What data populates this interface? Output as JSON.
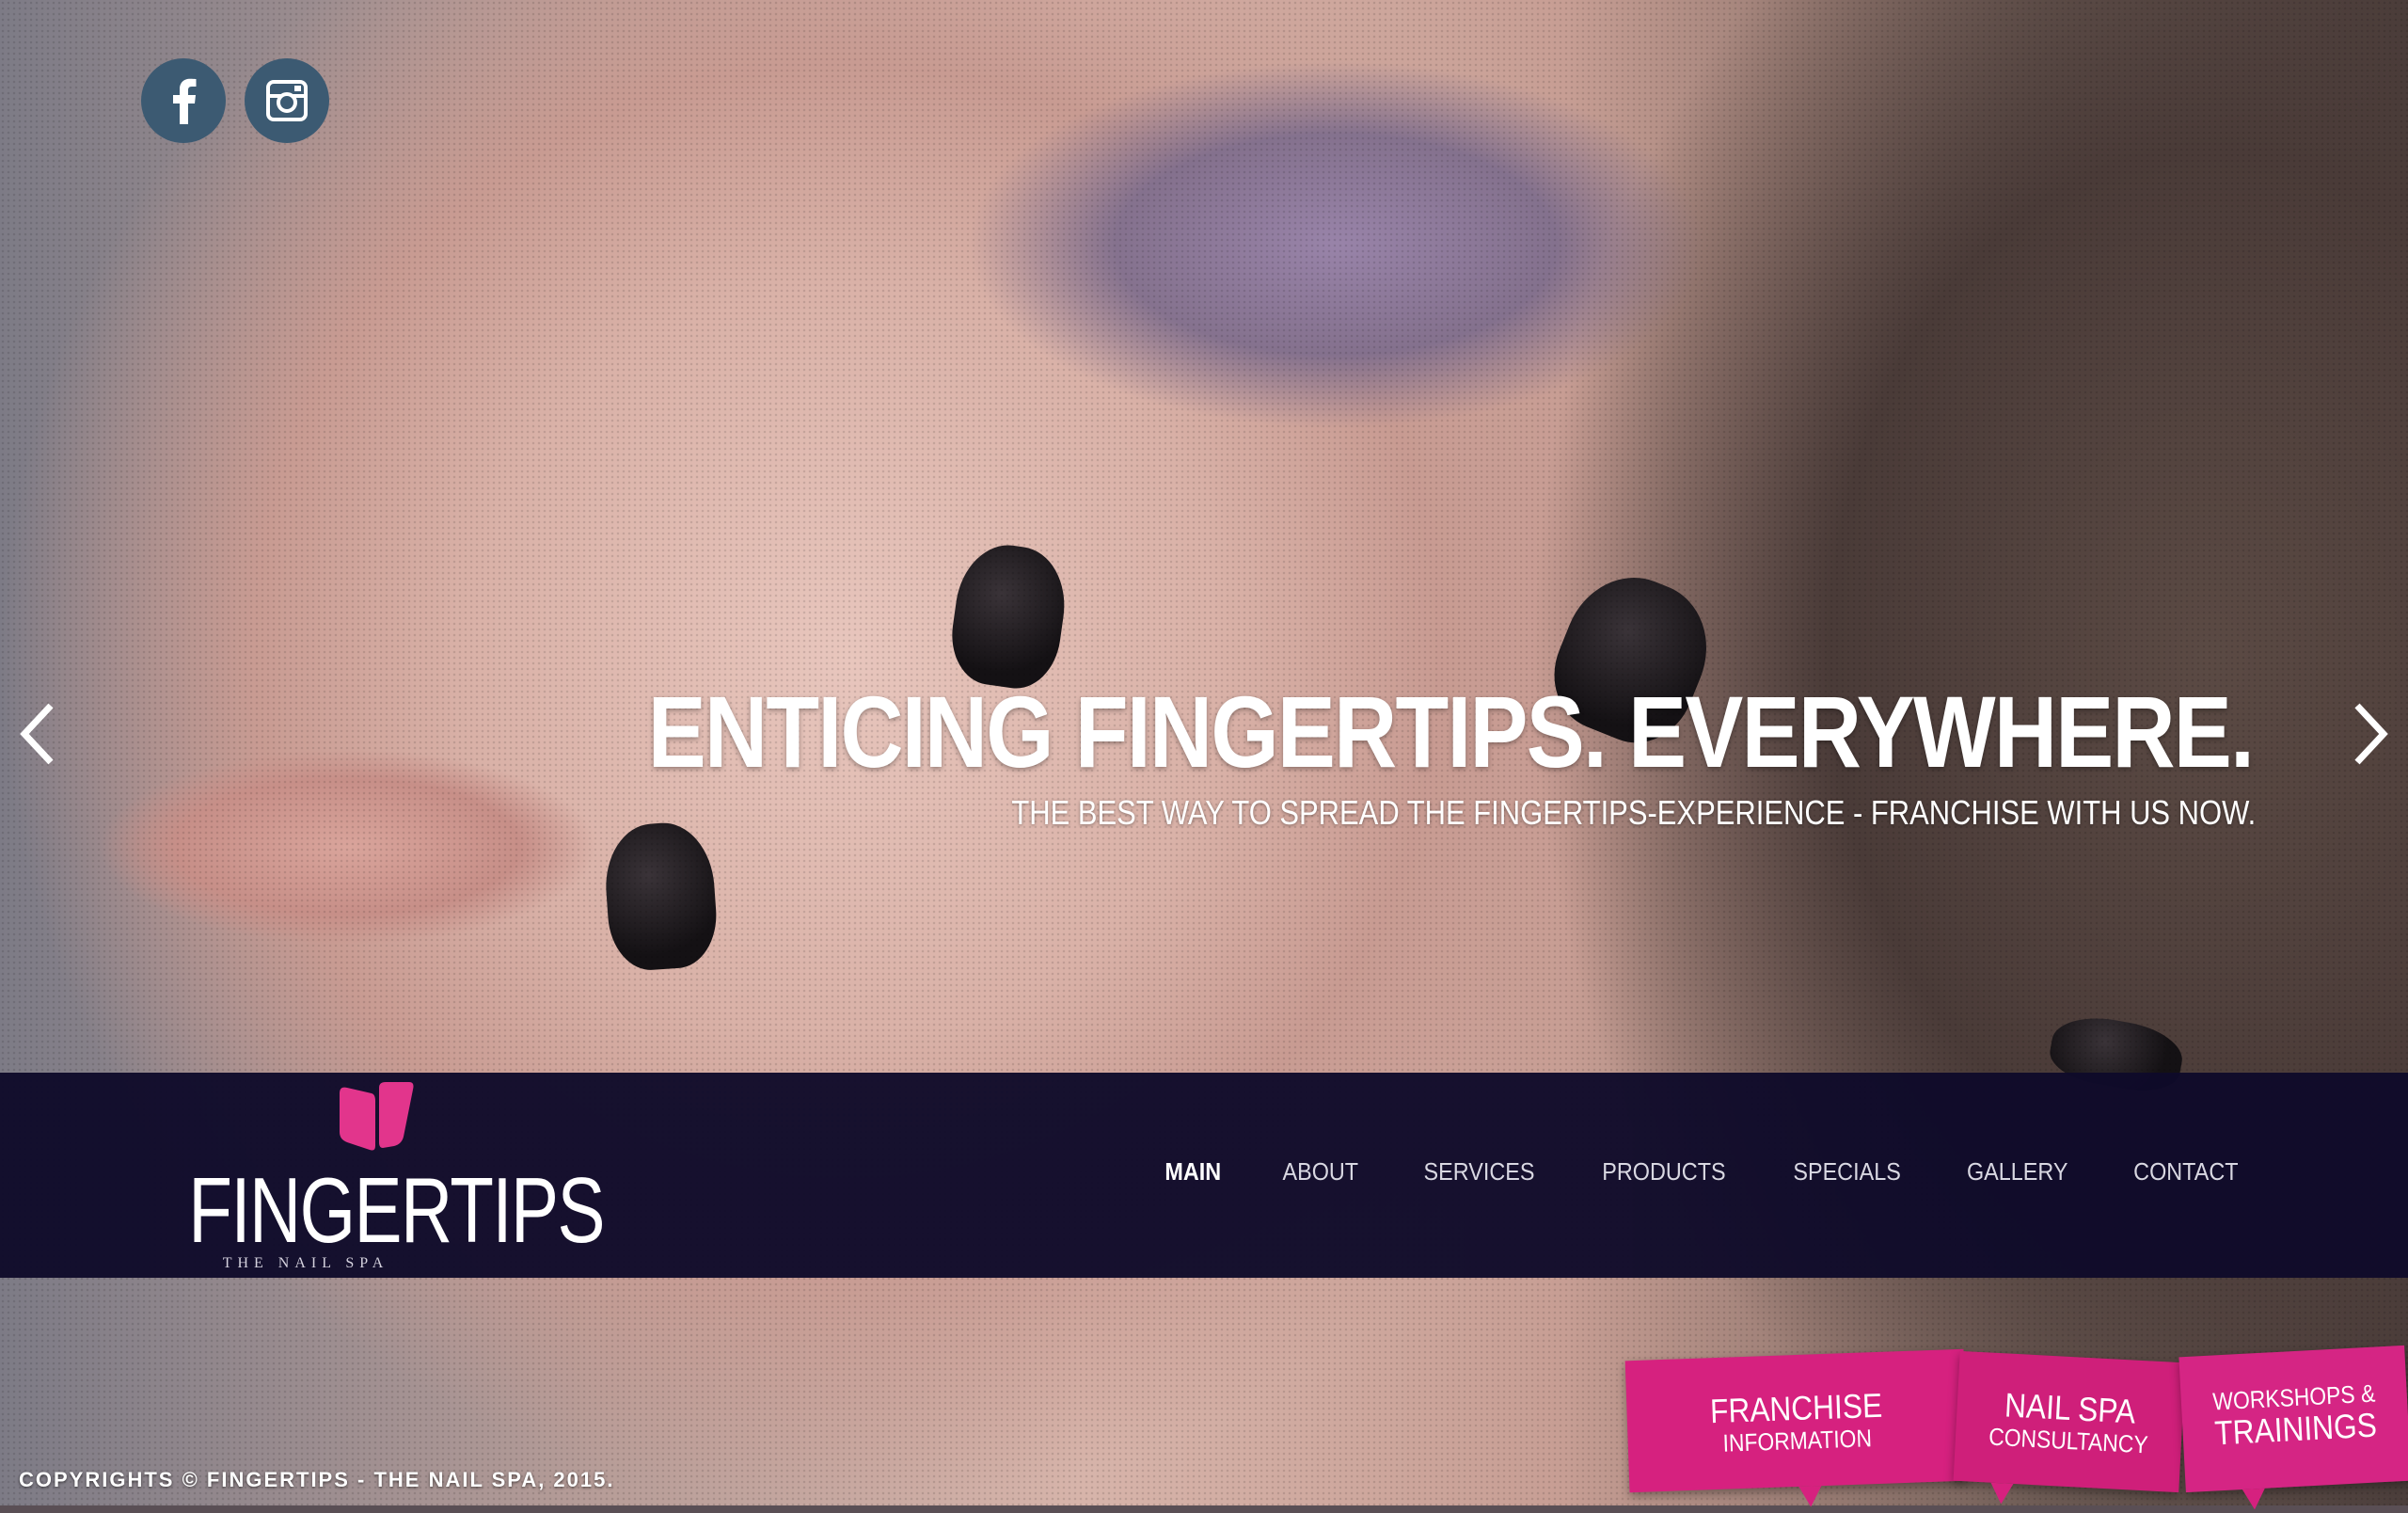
{
  "brand": {
    "name": "FINGERTIPS",
    "tagline": "THE NAIL SPA",
    "accent_color": "#e2358c",
    "nav_bg_color": "#0f0a2a",
    "social_color": "#3c5a72"
  },
  "social": [
    {
      "icon": "facebook-icon"
    },
    {
      "icon": "instagram-icon"
    }
  ],
  "slider": {
    "headline": "ENTICING FINGERTIPS. EVERYWHERE.",
    "subline": "THE BEST WAY TO SPREAD THE FINGERTIPS-EXPERIENCE - FRANCHISE WITH US NOW.",
    "prev_icon": "chevron-left-icon",
    "next_icon": "chevron-right-icon"
  },
  "nav": {
    "items": [
      {
        "label": "MAIN",
        "active": true
      },
      {
        "label": "ABOUT",
        "active": false
      },
      {
        "label": "SERVICES",
        "active": false
      },
      {
        "label": "PRODUCTS",
        "active": false
      },
      {
        "label": "SPECIALS",
        "active": false
      },
      {
        "label": "GALLERY",
        "active": false
      },
      {
        "label": "CONTACT",
        "active": false
      }
    ]
  },
  "tags": [
    {
      "line1": "FRANCHISE",
      "line2": "INFORMATION"
    },
    {
      "line1": "NAIL SPA",
      "line2": "CONSULTANCY"
    },
    {
      "line1": "WORKSHOPS &",
      "line2": "TRAININGS"
    }
  ],
  "footer": {
    "copyright": "COPYRIGHTS © FINGERTIPS - THE NAIL SPA, 2015."
  }
}
